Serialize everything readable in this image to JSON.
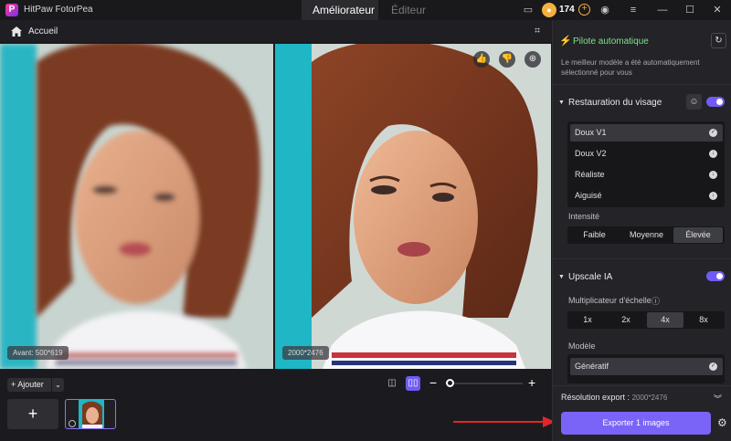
{
  "window": {
    "app_title": "HitPaw FotorPea",
    "logo_letter": "P",
    "tabs": [
      "Améliorateur",
      "Éditeur"
    ],
    "coins": "174"
  },
  "breadcrumb": {
    "home": "Accueil"
  },
  "preview": {
    "before_label": "Avant: 500*619",
    "after_label": "2000*2476"
  },
  "bottom": {
    "add_label": "+ Ajouter",
    "big_add": "+"
  },
  "sidebar": {
    "auto_title": "Pilote automatique",
    "auto_desc": "Le meilleur modèle a été automatiquement sélectionné pour vous",
    "face": {
      "title": "Restauration du visage",
      "models": [
        "Doux V1",
        "Doux V2",
        "Réaliste",
        "Aiguisé"
      ],
      "selected_model": "Doux V1",
      "intensity_label": "Intensité",
      "intensity_options": [
        "Faible",
        "Moyenne",
        "Élevée"
      ],
      "selected_intensity": "Élevée"
    },
    "upscale": {
      "title": "Upscale IA",
      "multiplier_label": "Multiplicateur d'échelle",
      "multipliers": [
        "1x",
        "2x",
        "4x",
        "8x"
      ],
      "selected_multiplier": "4x",
      "model_label": "Modèle",
      "model_selected": "Génératif"
    },
    "export_res_label": "Résolution export :",
    "export_res_value": "2000*2476",
    "export_button": "Exporter 1 images"
  },
  "colors": {
    "accent": "#7a63f7",
    "toggle": "#6f5cf6",
    "auto_green": "#7ee38a",
    "arrow": "#e0262b"
  }
}
